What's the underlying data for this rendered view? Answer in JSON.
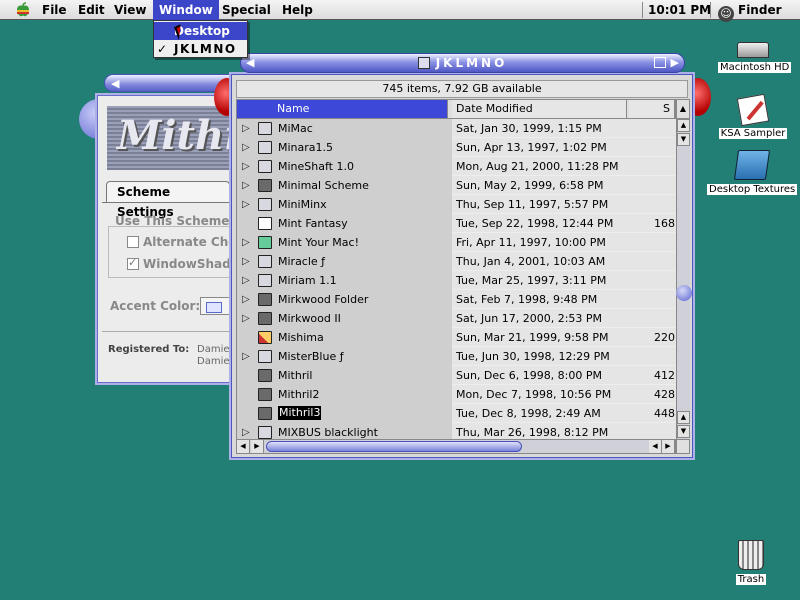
{
  "menubar": {
    "apple": "",
    "items": [
      "File",
      "Edit",
      "View",
      "Window",
      "Special",
      "Help"
    ],
    "clock": "10:01 PM",
    "app": "Finder"
  },
  "window_menu": {
    "items": [
      "Desktop",
      "JKLMNO"
    ],
    "checked": "JKLMNO",
    "check_mark": "✓"
  },
  "scheme_window": {
    "banner": "Mithril",
    "tab": "Scheme Settings",
    "use_scheme_label": "Use This Scheme's",
    "alternate_check_label": "Alternate Che",
    "windowshade_label": "WindowShade",
    "accent_label": "Accent Color:",
    "registered_label": "Registered To:",
    "registered_value_1": "Damien",
    "registered_value_2": "Damien"
  },
  "finder_window": {
    "title": "JKLMNO",
    "info": "745 items, 7.92 GB available",
    "columns": {
      "name": "Name",
      "date": "Date Modified",
      "size": "S"
    },
    "rows": [
      {
        "name": "MiMac",
        "date": "Sat, Jan 30, 1999, 1:15 PM",
        "size": "",
        "folder": true,
        "icon": "system-folder-icon"
      },
      {
        "name": "Minara1.5",
        "date": "Sun, Apr 13, 1997, 1:02 PM",
        "size": "",
        "folder": true,
        "icon": "folder-icon"
      },
      {
        "name": "MineShaft 1.0",
        "date": "Mon, Aug 21, 2000, 11:28 PM",
        "size": "",
        "folder": true,
        "icon": "folder-icon"
      },
      {
        "name": "Minimal Scheme",
        "date": "Sun, May 2, 1999, 6:58 PM",
        "size": "",
        "folder": true,
        "icon": "dark-folder-icon"
      },
      {
        "name": "MiniMinx",
        "date": "Thu, Sep 11, 1997, 5:57 PM",
        "size": "",
        "folder": true,
        "icon": "folder-icon"
      },
      {
        "name": "Mint Fantasy",
        "date": "Tue, Sep 22, 1998, 12:44 PM",
        "size": "168",
        "folder": false,
        "icon": "document-icon"
      },
      {
        "name": "Mint Your Mac!",
        "date": "Fri, Apr 11, 1997, 10:00 PM",
        "size": "",
        "folder": true,
        "icon": "green-folder-icon"
      },
      {
        "name": "Miracle ƒ",
        "date": "Thu, Jan 4, 2001, 10:03 AM",
        "size": "",
        "folder": true,
        "icon": "folder-icon"
      },
      {
        "name": "Miriam 1.1",
        "date": "Tue, Mar 25, 1997, 3:11 PM",
        "size": "",
        "folder": true,
        "icon": "folder-icon"
      },
      {
        "name": "Mirkwood Folder",
        "date": "Sat, Feb 7, 1998, 9:48 PM",
        "size": "",
        "folder": true,
        "icon": "dark-folder-icon"
      },
      {
        "name": "Mirkwood II",
        "date": "Sat, Jun 17, 2000, 2:53 PM",
        "size": "",
        "folder": true,
        "icon": "dark-folder-icon"
      },
      {
        "name": "Mishima",
        "date": "Sun, Mar 21, 1999, 9:58 PM",
        "size": "220",
        "folder": false,
        "icon": "color-document-icon"
      },
      {
        "name": "MisterBlue ƒ",
        "date": "Tue, Jun 30, 1998, 12:29 PM",
        "size": "",
        "folder": true,
        "icon": "folder-icon"
      },
      {
        "name": "Mithril",
        "date": "Sun, Dec 6, 1998, 8:00 PM",
        "size": "412",
        "folder": false,
        "icon": "scheme-file-icon"
      },
      {
        "name": "Mithril2",
        "date": "Mon, Dec 7, 1998, 10:56 PM",
        "size": "428",
        "folder": false,
        "icon": "scheme-file-icon"
      },
      {
        "name": "Mithril3",
        "date": "Tue, Dec 8, 1998, 2:49 AM",
        "size": "448",
        "folder": false,
        "icon": "scheme-file-icon",
        "selected": true
      },
      {
        "name": "MIXBUS blacklight",
        "date": "Thu, Mar 26, 1998, 8:12 PM",
        "size": "",
        "folder": true,
        "icon": "folder-icon"
      }
    ]
  },
  "desktop_icons": [
    {
      "label": "Macintosh HD",
      "icon": "hard-drive-icon"
    },
    {
      "label": "KSA Sampler",
      "icon": "document-icon"
    },
    {
      "label": "Desktop Textures",
      "icon": "folder-icon"
    },
    {
      "label": "Trash",
      "icon": "trash-icon"
    }
  ],
  "colors": {
    "desktop": "#217f76",
    "highlight": "#3b46c8",
    "accent": "#5b63c8"
  }
}
